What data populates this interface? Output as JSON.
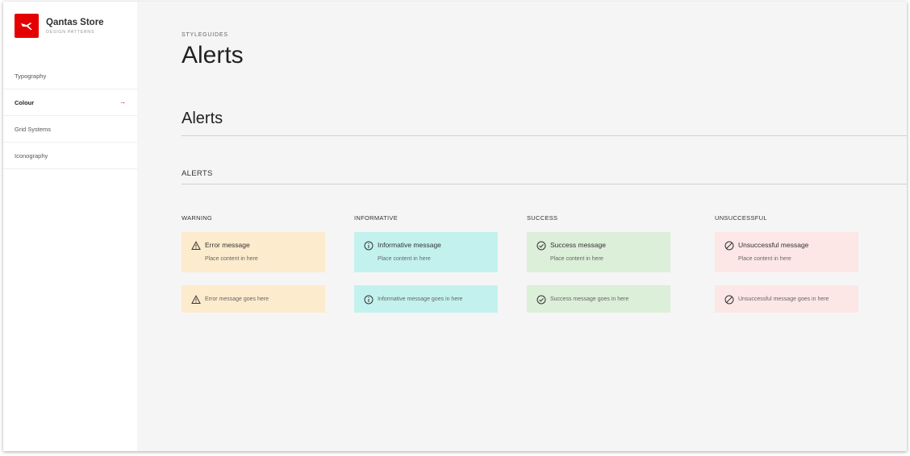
{
  "brand": {
    "title": "Qantas Store",
    "subtitle": "DESIGN PATTERNS",
    "color": "#e40000"
  },
  "nav": {
    "items": [
      {
        "label": "Typography",
        "active": false
      },
      {
        "label": "Colour",
        "active": true
      },
      {
        "label": "Grid Systems",
        "active": false
      },
      {
        "label": "Iconography",
        "active": false
      }
    ],
    "active_arrow": "→"
  },
  "header": {
    "eyebrow": "STYLEGUIDES",
    "title": "Alerts"
  },
  "section": {
    "title": "Alerts",
    "subtitle": "ALERTS"
  },
  "columns": [
    {
      "title": "WARNING",
      "icon": "warning-triangle-icon",
      "color": "#fdebcd",
      "alert_title": "Error message",
      "alert_body": "Place content in here",
      "compact_text": "Error message goes here"
    },
    {
      "title": "INFORMATIVE",
      "icon": "info-circle-icon",
      "color": "#c3f2ee",
      "alert_title": "Informative message",
      "alert_body": "Place content in here",
      "compact_text": "Informative message goes in here"
    },
    {
      "title": "SUCCESS",
      "icon": "check-circle-icon",
      "color": "#dcefd9",
      "alert_title": "Success message",
      "alert_body": "Place content in here",
      "compact_text": "Success message goes in here"
    },
    {
      "title": "UNSUCCESSFUL",
      "icon": "blocked-circle-icon",
      "color": "#fde6e6",
      "alert_title": "Unsuccessful message",
      "alert_body": "Place content in here",
      "compact_text": "Unsuccessful message goes in here"
    }
  ]
}
